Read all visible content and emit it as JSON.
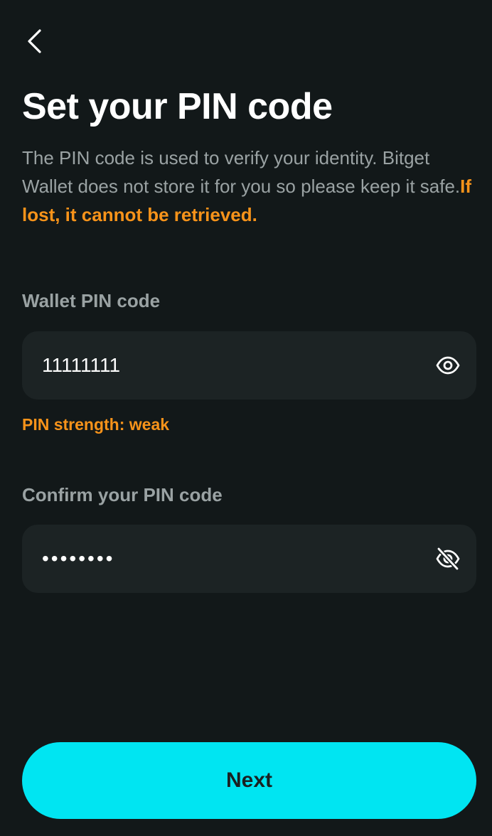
{
  "header": {
    "back_icon": "chevron-left-icon",
    "title": "Set your PIN code"
  },
  "description": {
    "text": "The PIN code is used to verify your identity. Bitget Wallet does not store it for you so please keep it safe.",
    "warning": "If lost, it cannot be retrieved."
  },
  "pin_field": {
    "label": "Wallet PIN code",
    "value": "11111111",
    "visibility_icon": "eye-icon",
    "strength_text": "PIN strength: weak"
  },
  "confirm_field": {
    "label": "Confirm your PIN code",
    "value": "11111111",
    "visibility_icon": "eye-off-icon"
  },
  "footer": {
    "next_label": "Next"
  },
  "colors": {
    "background": "#121819",
    "input_background": "#1c2324",
    "muted_text": "#9aa2a3",
    "warning": "#f7931a",
    "accent": "#00e5f2"
  }
}
